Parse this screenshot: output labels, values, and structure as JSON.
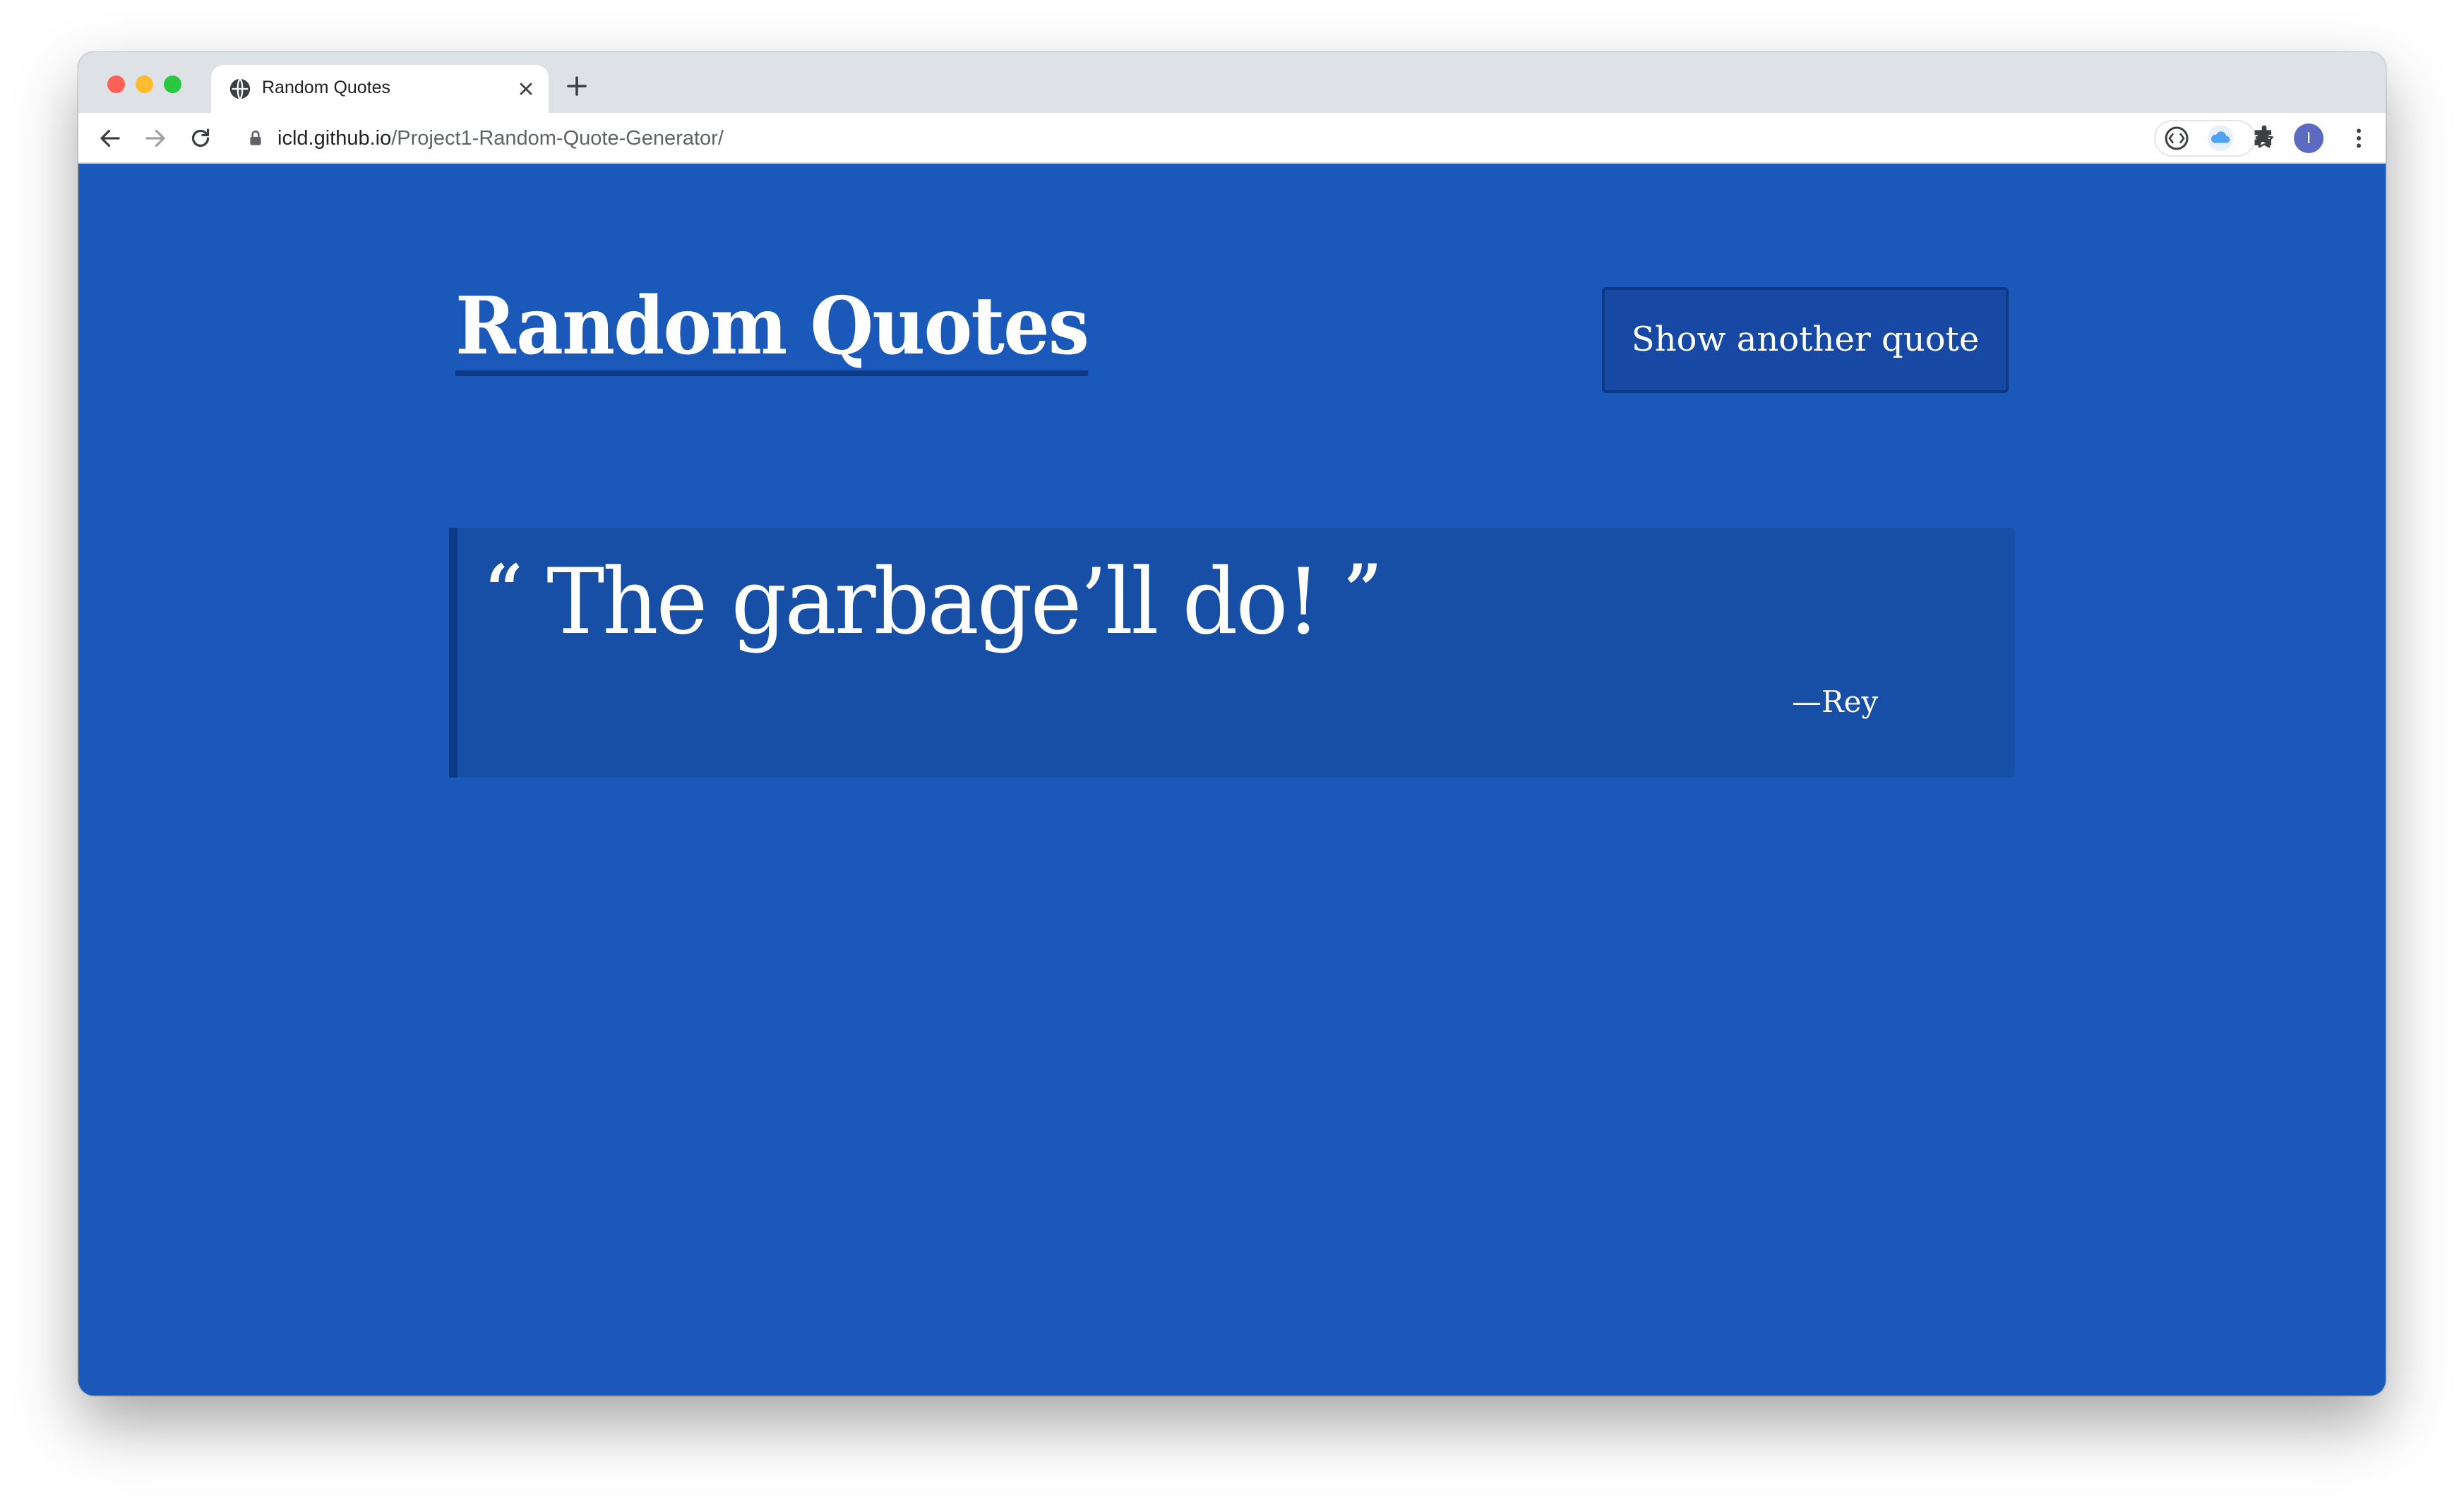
{
  "browser": {
    "tab_title": "Random Quotes",
    "url_host": "icld.github.io",
    "url_path": "/Project1-Random-Quote-Generator/",
    "avatar_initial": "I",
    "icons": {
      "favicon": "globe-icon",
      "tab_close": "close-icon",
      "new_tab": "plus-icon",
      "back": "arrow-left-icon",
      "forward": "arrow-right-icon",
      "reload": "reload-icon",
      "lock": "lock-icon",
      "bookmark": "star-icon",
      "extension_1": "code-brackets-icon",
      "extension_2": "cloud-icon",
      "extensions_menu": "puzzle-icon",
      "menu": "kebab-menu-icon"
    }
  },
  "page": {
    "title": "Random Quotes",
    "button_label": "Show another quote",
    "quote": {
      "open_mark": "“",
      "text": "The garbage’ll do!",
      "close_mark": "”",
      "source": "—Rey"
    }
  },
  "colors": {
    "page_background": "#1a58b9",
    "quote_box_background": "#174ea6",
    "accent_dark": "#0c3985",
    "text": "#ffffff"
  }
}
